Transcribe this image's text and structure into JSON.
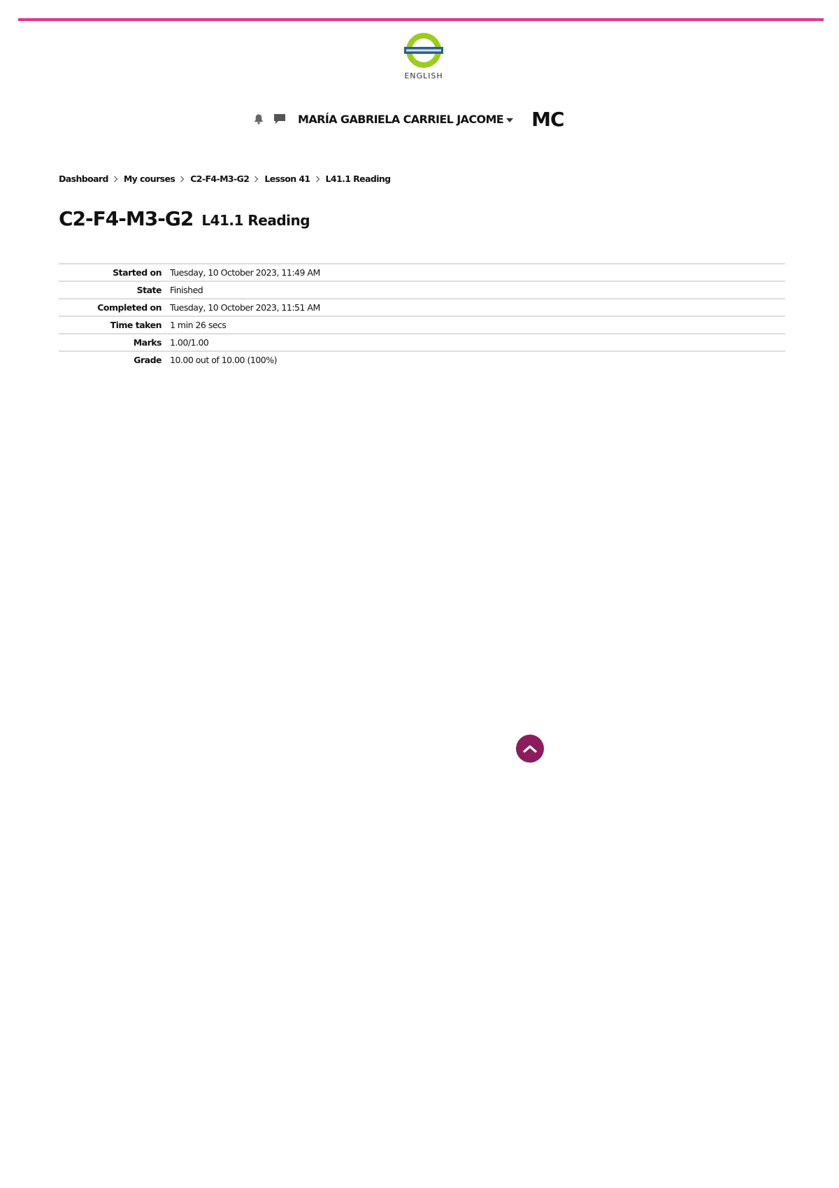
{
  "brand": {
    "logo_word": "ENGLISH",
    "accent_color": "#e0368a",
    "ring_color": "#9ccc1c",
    "band_color": "#2f5f8a",
    "back_to_top_color": "#8c1d5c"
  },
  "header": {
    "notification_icon": "bell-icon",
    "messages_icon": "chat-icon",
    "user_name": "MARÍA GABRIELA CARRIEL JACOME",
    "avatar_initials": "MC"
  },
  "breadcrumb": [
    "Dashboard",
    "My courses",
    "C2-F4-M3-G2",
    "Lesson 41",
    "L41.1 Reading"
  ],
  "page": {
    "course": "C2-F4-M3-G2",
    "activity": "L41.1 Reading"
  },
  "summary": [
    {
      "label": "Started on",
      "value": "Tuesday, 10 October 2023, 11:49 AM"
    },
    {
      "label": "State",
      "value": "Finished"
    },
    {
      "label": "Completed on",
      "value": "Tuesday, 10 October 2023, 11:51 AM"
    },
    {
      "label": "Time taken",
      "value": "1 min 26 secs"
    },
    {
      "label": "Marks",
      "value": "1.00/1.00"
    },
    {
      "label": "Grade",
      "value": "10.00 out of 10.00 (100%)"
    }
  ]
}
